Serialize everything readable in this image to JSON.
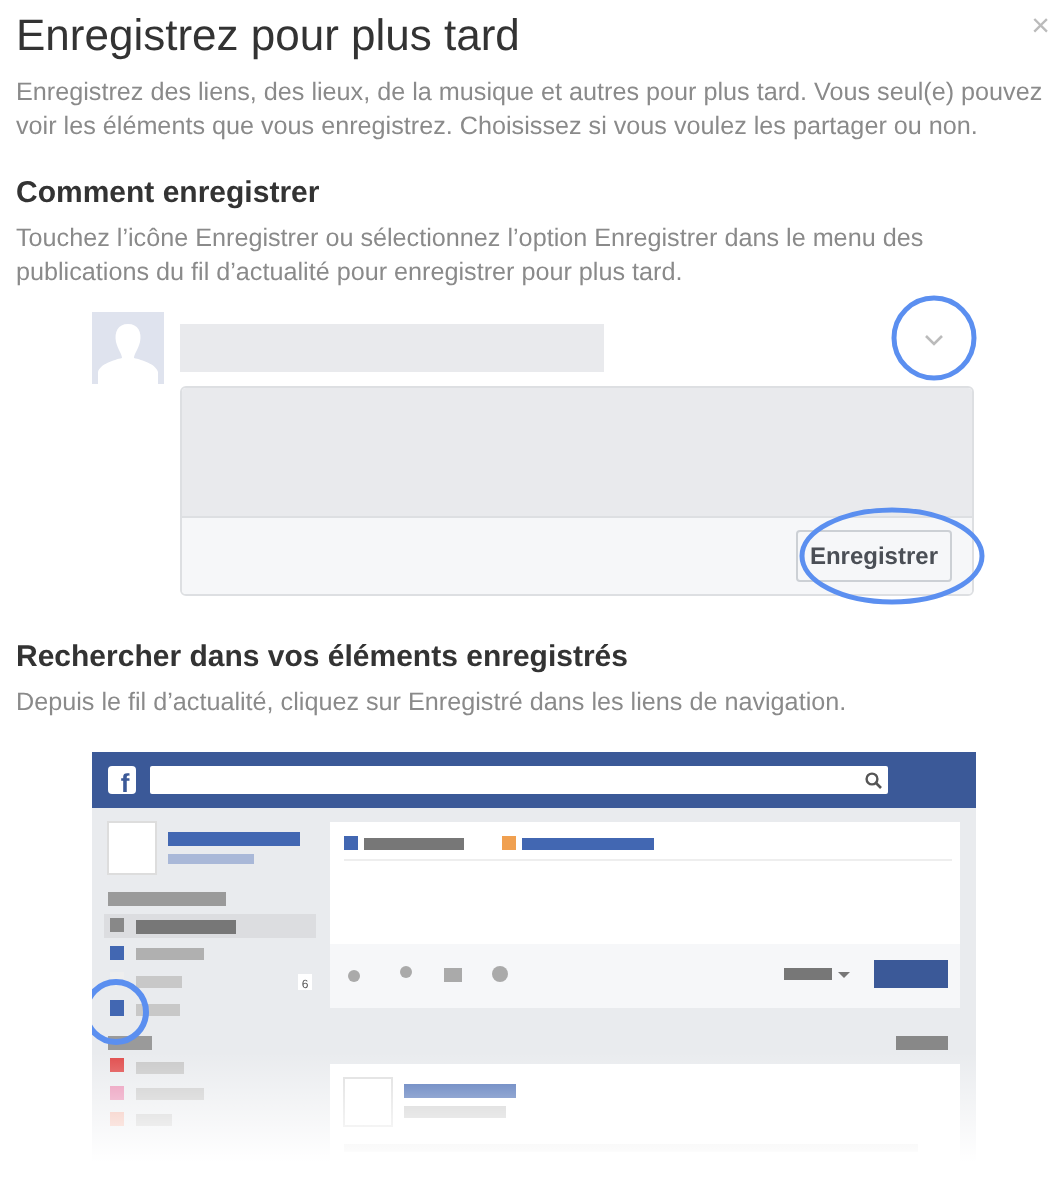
{
  "dialog": {
    "title": "Enregistrez pour plus tard",
    "close": "×",
    "intro": "Enregistrez des liens, des lieux, de la musique et autres pour plus tard. Vous seul(e) pouvez voir les éléments que vous enregistrez. Choisissez si vous voulez les partager ou non."
  },
  "sections": [
    {
      "heading": "Comment enregistrer",
      "text": "Touchez l’icône Enregistrer ou sélectionnez l’option Enregistrer dans le menu des publications du fil d’actualité pour enregistrer pour plus tard."
    },
    {
      "heading": "Rechercher dans vos éléments enregistrés",
      "text": "Depuis le fil d’actualité, cliquez sur Enregistré dans les liens de navigation."
    }
  ],
  "post_preview": {
    "save_button": "Enregistrer"
  },
  "feed_mockup": {
    "logo": "f",
    "badge_count": "6"
  }
}
